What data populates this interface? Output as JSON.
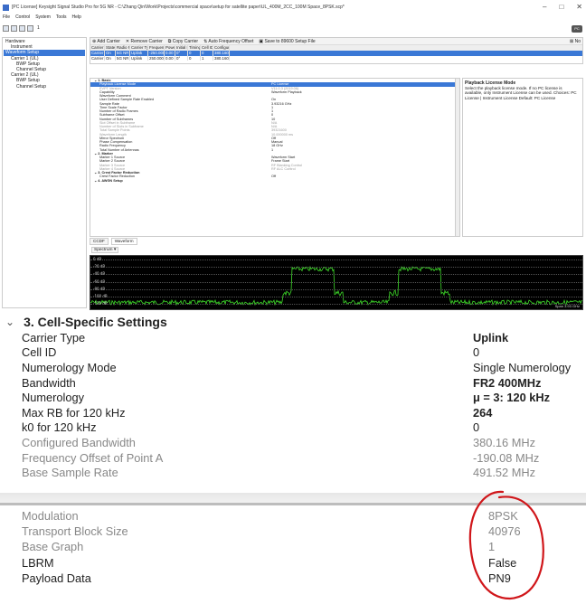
{
  "window": {
    "title": "[PC License] Keysight Signal Studio Pro for 5G NR - C:\\Zhang Qin\\Work\\Projects\\commercial space\\setup for satellite paper\\UL_400M_2CC_100M Space_8PSK.scp*",
    "controls": [
      "–",
      "□",
      "✕"
    ]
  },
  "menu": [
    "File",
    "Control",
    "System",
    "Tools",
    "Help"
  ],
  "toolbar": {
    "run_label": "1",
    "license_badge": "PC"
  },
  "tree": {
    "items": [
      {
        "label": "Hardware",
        "level": 0,
        "selected": false
      },
      {
        "label": "Instrument",
        "level": 1,
        "selected": false
      },
      {
        "label": "Waveform Setup",
        "level": 0,
        "selected": true
      },
      {
        "label": "Carrier 1 (UL)",
        "level": 1,
        "selected": false
      },
      {
        "label": "BWP Setup",
        "level": 2,
        "selected": false
      },
      {
        "label": "Channel Setup",
        "level": 2,
        "selected": false
      },
      {
        "label": "Carrier 2 (UL)",
        "level": 1,
        "selected": false
      },
      {
        "label": "BWP Setup",
        "level": 2,
        "selected": false
      },
      {
        "label": "Channel Setup",
        "level": 2,
        "selected": false
      }
    ]
  },
  "carrier_toolbar": {
    "add": "Add Carrier",
    "remove": "Remove Carrier",
    "copy": "Copy Carrier",
    "auto_freq": "Auto Frequency Offset",
    "save": "Save to 89600 Setup File",
    "close": "No"
  },
  "carrier_table": {
    "headers": [
      "Carrier",
      "State",
      "Radio F.",
      "Carrier Type",
      "Frequency",
      "Power",
      "Initial P.",
      "Timing",
      "Cell ID",
      "Configured"
    ],
    "rows": [
      {
        "cells": [
          "Carrier",
          "On",
          "5G NR",
          "Uplink",
          "-250.000 M...",
          "0.00",
          "0°",
          "0",
          "0",
          "380.160 MHz"
        ],
        "selected": true
      },
      {
        "cells": [
          "Carrier",
          "On",
          "5G NR",
          "Uplink",
          "250.000 MHz",
          "0.00",
          "0°",
          "0",
          "1",
          "380.160 MHz"
        ],
        "selected": false
      }
    ]
  },
  "properties": [
    {
      "name": "1. Basic",
      "value": "",
      "type": "section"
    },
    {
      "name": "Playback License Mode",
      "value": "PC License",
      "type": "selected"
    },
    {
      "name": "EVPT Version",
      "value": "V11.0.3 (2019.06)",
      "type": "dim"
    },
    {
      "name": "Capability",
      "value": "Waveform Playback",
      "type": "normal"
    },
    {
      "name": "Waveform Comment",
      "value": "",
      "type": "normal"
    },
    {
      "name": "User Defined Sample Rate Enabled",
      "value": "On",
      "type": "normal"
    },
    {
      "name": "Sample Rate",
      "value": "3.93216 GHz",
      "type": "normal"
    },
    {
      "name": "Time Scale Factor",
      "value": "1",
      "type": "normal"
    },
    {
      "name": "Number of Radio Frames",
      "value": "1",
      "type": "normal"
    },
    {
      "name": "Subframe Offset",
      "value": "0",
      "type": "normal"
    },
    {
      "name": "Number of Subframes",
      "value": "10",
      "type": "normal"
    },
    {
      "name": "Slot Offset in Subframe",
      "value": "N/A",
      "type": "dim"
    },
    {
      "name": "Number of Slots in Subframe",
      "value": "N/A",
      "type": "dim"
    },
    {
      "name": "Total Sample Points",
      "value": "39321600",
      "type": "dim"
    },
    {
      "name": "Waveform Length",
      "value": "10.000000 ms",
      "type": "dim"
    },
    {
      "name": "Mirror Spectrum",
      "value": "Off",
      "type": "normal"
    },
    {
      "name": "Phase Compensation",
      "value": "Manual",
      "type": "normal"
    },
    {
      "name": "Radio Frequency",
      "value": "18 GHz",
      "type": "normal"
    },
    {
      "name": "Total Number of Antennas",
      "value": "1",
      "type": "normal"
    },
    {
      "name": "2. Marker",
      "value": "",
      "type": "section"
    },
    {
      "name": "Marker 1 Source",
      "value": "Waveform Start",
      "type": "normal"
    },
    {
      "name": "Marker 2 Source",
      "value": "Frame Start",
      "type": "normal"
    },
    {
      "name": "Marker 3 Source",
      "value": "RF Blanking Control",
      "type": "dim"
    },
    {
      "name": "Marker 4 Source",
      "value": "RF ALC Control",
      "type": "dim"
    },
    {
      "name": "3. Crest Factor Reduction",
      "value": "",
      "type": "section"
    },
    {
      "name": "Crest Factor Reduction",
      "value": "Off",
      "type": "normal"
    },
    {
      "name": "4. AWGN Setup",
      "value": "",
      "type": "section"
    }
  ],
  "help": {
    "title": "Playback License Mode",
    "body": "Select the playback license mode. If no PC license is available, only Instrument License can be used. Choices: PC License | Instrument License Default: PC License"
  },
  "view_tabs": [
    "CCDF",
    "Waveform"
  ],
  "spectrum": {
    "label": "Spectrum",
    "y_ticks": [
      "0 dB",
      "-20 dB",
      "-40 dB",
      "-60 dB",
      "-80 dB",
      "-100 dB",
      "-120 dB"
    ],
    "span_text": "Span 3.93 GHz"
  },
  "cell_settings": {
    "section_title": "3. Cell-Specific Settings",
    "rows": [
      {
        "label": "Carrier Type",
        "value": "Uplink",
        "style": "bold"
      },
      {
        "label": "Cell ID",
        "value": "0",
        "style": "normal"
      },
      {
        "label": "Numerology Mode",
        "value": "Single Numerology",
        "style": "normal"
      },
      {
        "label": "Bandwidth",
        "value": "FR2 400MHz",
        "style": "bold"
      },
      {
        "label": "Numerology",
        "value": "μ = 3: 120 kHz",
        "style": "bold"
      },
      {
        "label": "Max RB for 120 kHz",
        "value": "264",
        "style": "bold"
      },
      {
        "label": "k0 for 120 kHz",
        "value": "0",
        "style": "normal"
      },
      {
        "label": "Configured Bandwidth",
        "value": "380.16 MHz",
        "style": "dim"
      },
      {
        "label": "Frequency Offset of Point A",
        "value": "-190.08 MHz",
        "style": "dim"
      },
      {
        "label": "Base Sample Rate",
        "value": "491.52 MHz",
        "style": "dim"
      }
    ]
  },
  "channel_settings": {
    "rows": [
      {
        "label": "Modulation",
        "value": "8PSK",
        "style": "dim"
      },
      {
        "label": "Transport Block Size",
        "value": "40976",
        "style": "dim"
      },
      {
        "label": "Base Graph",
        "value": "1",
        "style": "dim"
      },
      {
        "label": "LBRM",
        "value": "False",
        "style": "normal"
      },
      {
        "label": "Payload Data",
        "value": "PN9",
        "style": "normal"
      }
    ]
  },
  "colors": {
    "selection": "#3a78d6",
    "annotation": "#d0161a",
    "spectrum_trace": "#3fdc2a"
  }
}
